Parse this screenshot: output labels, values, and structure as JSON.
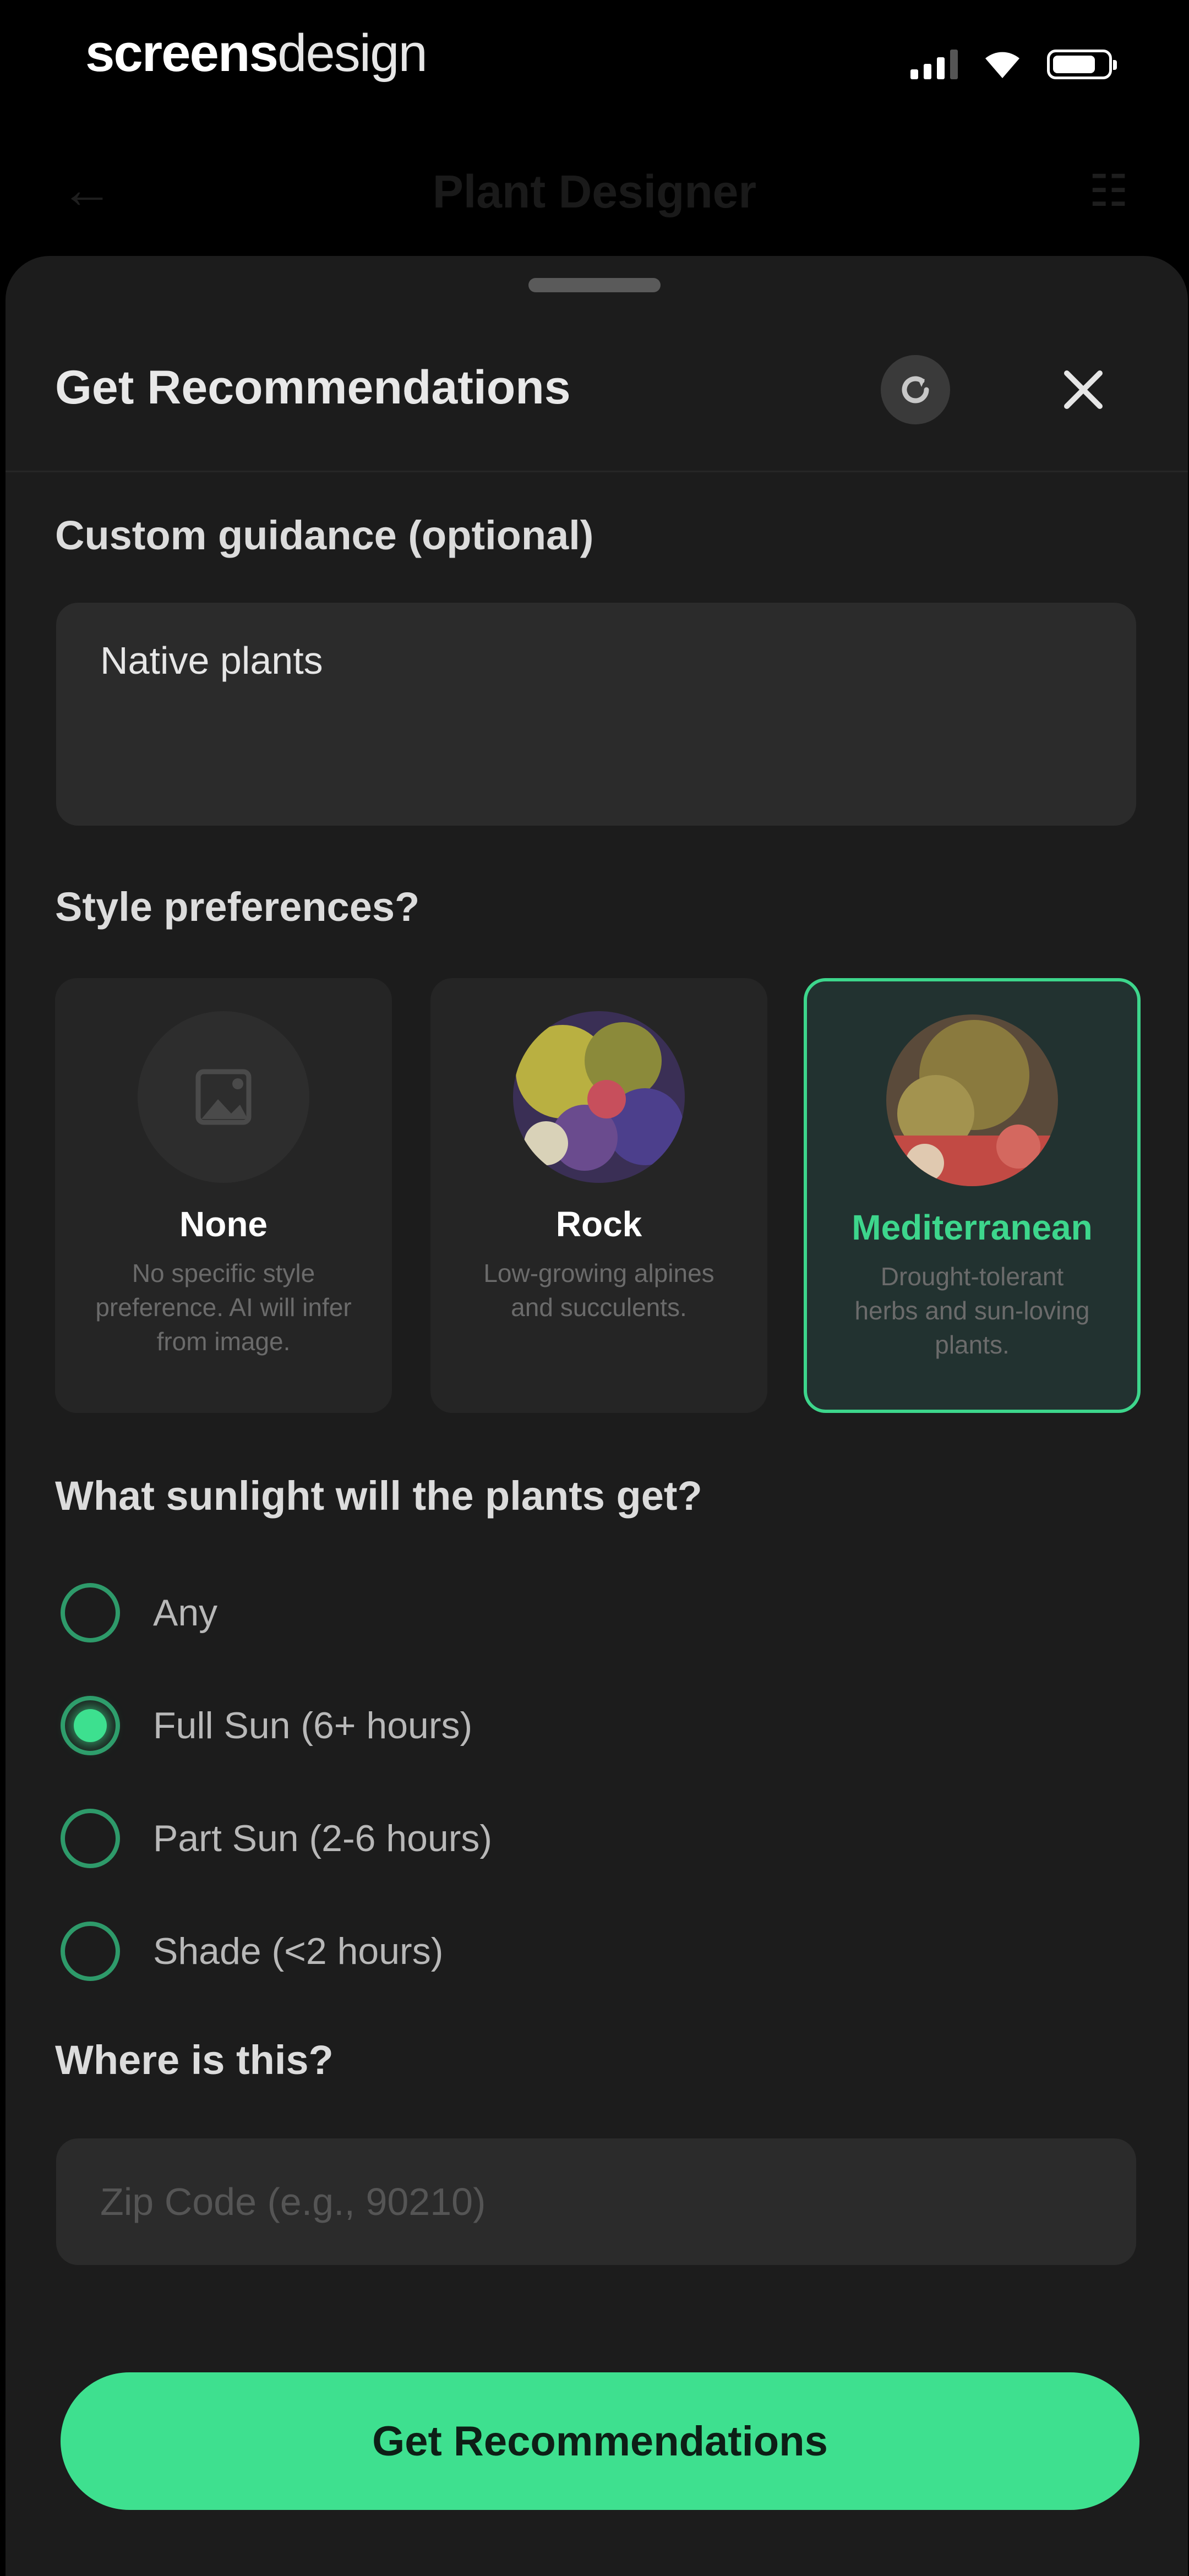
{
  "status_bar": {
    "brand_bold": "screens",
    "brand_light": "design",
    "icons": [
      "signal-icon",
      "wifi-icon",
      "battery-icon"
    ]
  },
  "background_nav": {
    "title": "Plant Designer"
  },
  "sheet": {
    "title": "Get Recommendations",
    "refresh_icon": "refresh-icon",
    "close_icon": "close-icon"
  },
  "guidance": {
    "label": "Custom guidance (optional)",
    "value": "Native plants"
  },
  "style": {
    "label": "Style preferences?",
    "options": [
      {
        "name": "None",
        "desc": "No specific style preference. AI will infer from image.",
        "selected": false
      },
      {
        "name": "Rock",
        "desc": "Low-growing alpines and succulents.",
        "selected": false
      },
      {
        "name": "Mediterranean",
        "desc": "Drought-tolerant herbs and sun-loving plants.",
        "selected": true
      }
    ]
  },
  "sunlight": {
    "label": "What sunlight will the plants get?",
    "options": [
      {
        "label": "Any",
        "selected": false
      },
      {
        "label": "Full Sun (6+ hours)",
        "selected": true
      },
      {
        "label": "Part Sun (2-6 hours)",
        "selected": false
      },
      {
        "label": "Shade (<2 hours)",
        "selected": false
      }
    ]
  },
  "location": {
    "label": "Where is this?",
    "placeholder": "Zip Code (e.g., 90210)"
  },
  "cta": {
    "label": "Get Recommendations"
  },
  "colors": {
    "accent": "#3ee08f",
    "sheet_bg": "#1c1c1c",
    "field_bg": "#2b2b2b"
  }
}
